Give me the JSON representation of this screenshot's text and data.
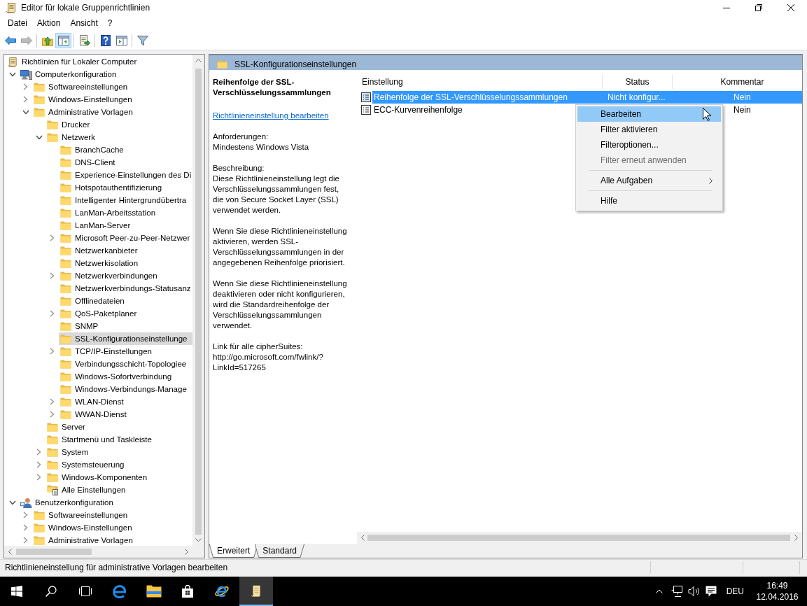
{
  "window": {
    "title": "Editor für lokale Gruppenrichtlinien"
  },
  "menu": [
    "Datei",
    "Aktion",
    "Ansicht",
    "?"
  ],
  "toolbar": [
    {
      "kind": "back",
      "disabled": false,
      "pressed": false
    },
    {
      "kind": "forward",
      "disabled": true,
      "pressed": false
    },
    {
      "kind": "separator"
    },
    {
      "kind": "up",
      "disabled": false,
      "pressed": false
    },
    {
      "kind": "tree",
      "disabled": false,
      "pressed": true
    },
    {
      "kind": "separator"
    },
    {
      "kind": "export",
      "disabled": false,
      "pressed": false
    },
    {
      "kind": "separator"
    },
    {
      "kind": "help",
      "disabled": false,
      "pressed": false
    },
    {
      "kind": "actions",
      "disabled": false,
      "pressed": false
    },
    {
      "kind": "separator"
    },
    {
      "kind": "filter",
      "disabled": false,
      "pressed": false
    }
  ],
  "tree": {
    "items": [
      {
        "label": "Richtlinien für Lokaler Computer",
        "kind": "root",
        "selected": false,
        "children": [
          {
            "label": "Computerkonfiguration",
            "kind": "computer",
            "expanded": true,
            "selected": false,
            "children": [
              {
                "label": "Softwareeinstellungen",
                "kind": "folder",
                "expanded": false,
                "selected": false
              },
              {
                "label": "Windows-Einstellungen",
                "kind": "folder",
                "expanded": false,
                "selected": false
              },
              {
                "label": "Administrative Vorlagen",
                "kind": "folder",
                "expanded": true,
                "selected": false,
                "children": [
                  {
                    "label": "Drucker",
                    "kind": "folder",
                    "selected": false
                  },
                  {
                    "label": "Netzwerk",
                    "kind": "folder",
                    "expanded": true,
                    "selected": false,
                    "children": [
                      {
                        "label": "BranchCache",
                        "kind": "folder",
                        "selected": false
                      },
                      {
                        "label": "DNS-Client",
                        "kind": "folder",
                        "selected": false
                      },
                      {
                        "label": "Experience-Einstellungen des Di",
                        "kind": "folder",
                        "selected": false
                      },
                      {
                        "label": "Hotspotauthentifizierung",
                        "kind": "folder",
                        "selected": false
                      },
                      {
                        "label": "Intelligenter Hintergrundübertra",
                        "kind": "folder",
                        "selected": false
                      },
                      {
                        "label": "LanMan-Arbeitsstation",
                        "kind": "folder",
                        "selected": false
                      },
                      {
                        "label": "LanMan-Server",
                        "kind": "folder",
                        "selected": false
                      },
                      {
                        "label": "Microsoft Peer-zu-Peer-Netzwer",
                        "kind": "folder",
                        "expanded": false,
                        "selected": false
                      },
                      {
                        "label": "Netzwerkanbieter",
                        "kind": "folder",
                        "selected": false
                      },
                      {
                        "label": "Netzwerkisolation",
                        "kind": "folder",
                        "selected": false
                      },
                      {
                        "label": "Netzwerkverbindungen",
                        "kind": "folder",
                        "expanded": false,
                        "selected": false
                      },
                      {
                        "label": "Netzwerkverbindungs-Statusanz",
                        "kind": "folder",
                        "selected": false
                      },
                      {
                        "label": "Offlinedateien",
                        "kind": "folder",
                        "selected": false
                      },
                      {
                        "label": "QoS-Paketplaner",
                        "kind": "folder",
                        "expanded": false,
                        "selected": false
                      },
                      {
                        "label": "SNMP",
                        "kind": "folder",
                        "selected": false
                      },
                      {
                        "label": "SSL-Konfigurationseinstellunge",
                        "kind": "folder",
                        "selected": true
                      },
                      {
                        "label": "TCP/IP-Einstellungen",
                        "kind": "folder",
                        "expanded": false,
                        "selected": false
                      },
                      {
                        "label": "Verbindungsschicht-Topologiee",
                        "kind": "folder",
                        "selected": false
                      },
                      {
                        "label": "Windows-Sofortverbindung",
                        "kind": "folder",
                        "selected": false
                      },
                      {
                        "label": "Windows-Verbindungs-Manage",
                        "kind": "folder",
                        "selected": false
                      },
                      {
                        "label": "WLAN-Dienst",
                        "kind": "folder",
                        "expanded": false,
                        "selected": false
                      },
                      {
                        "label": "WWAN-Dienst",
                        "kind": "folder",
                        "expanded": false,
                        "selected": false
                      }
                    ]
                  },
                  {
                    "label": "Server",
                    "kind": "folder",
                    "selected": false
                  },
                  {
                    "label": "Startmenü und Taskleiste",
                    "kind": "folder",
                    "selected": false
                  },
                  {
                    "label": "System",
                    "kind": "folder",
                    "expanded": false,
                    "selected": false
                  },
                  {
                    "label": "Systemsteuerung",
                    "kind": "folder",
                    "expanded": false,
                    "selected": false
                  },
                  {
                    "label": "Windows-Komponenten",
                    "kind": "folder",
                    "expanded": false,
                    "selected": false
                  },
                  {
                    "label": "Alle Einstellungen",
                    "kind": "all-settings",
                    "selected": false
                  }
                ]
              }
            ]
          },
          {
            "label": "Benutzerkonfiguration",
            "kind": "user",
            "expanded": true,
            "selected": false,
            "children": [
              {
                "label": "Softwareeinstellungen",
                "kind": "folder",
                "expanded": false,
                "selected": false
              },
              {
                "label": "Windows-Einstellungen",
                "kind": "folder",
                "expanded": false,
                "selected": false
              },
              {
                "label": "Administrative Vorlagen",
                "kind": "folder",
                "expanded": false,
                "selected": false
              }
            ]
          }
        ]
      }
    ]
  },
  "content": {
    "title": "SSL-Konfigurationseinstellungen",
    "details": {
      "title": "Reihenfolge der SSL-Verschlüsselungssammlungen",
      "link": "Richtlinieneinstellung bearbeiten",
      "requirements_label": "Anforderungen:",
      "requirements": "Mindestens Windows Vista",
      "description_label": "Beschreibung:",
      "paragraphs": [
        "Diese Richtlinieneinstellung legt die Verschlüsselungssammlungen fest, die von Secure Socket Layer (SSL) verwendet werden.",
        "Wenn Sie diese Richtlinieneinstellung aktivieren, werden SSL-Verschlüsselungssammlungen in der angegebenen Reihenfolge priorisiert.",
        "Wenn Sie diese Richtlinieneinstellung deaktivieren oder nicht konfigurieren, wird die Standardreihenfolge der Verschlüsselungssammlungen verwendet.",
        "Link für alle cipherSuites:\nhttp://go.microsoft.com/fwlink/?LinkId=517265"
      ]
    },
    "table": {
      "columns": [
        "Einstellung",
        "Status",
        "Kommentar"
      ],
      "rows": [
        {
          "name": "Reihenfolge der SSL-Verschlüsselungssammlungen",
          "status": "Nicht konfigur...",
          "comment": "Nein",
          "selected": true
        },
        {
          "name": "ECC-Kurvenreihenfolge",
          "comment": "Nein",
          "selected": false
        }
      ]
    },
    "view_tabs": [
      {
        "label": "Erweitert",
        "selected": true
      },
      {
        "label": "Standard",
        "selected": false
      }
    ]
  },
  "context_menu": {
    "items": [
      {
        "kind": "item",
        "label": "Bearbeiten",
        "selected": true,
        "disabled": false,
        "submenu": false
      },
      {
        "kind": "item",
        "label": "Filter aktivieren",
        "selected": false,
        "disabled": false,
        "submenu": false
      },
      {
        "kind": "item",
        "label": "Filteroptionen...",
        "selected": false,
        "disabled": false,
        "submenu": false
      },
      {
        "kind": "item",
        "label": "Filter erneut anwenden",
        "selected": false,
        "disabled": true,
        "submenu": false
      },
      {
        "kind": "separator"
      },
      {
        "kind": "item",
        "label": "Alle Aufgaben",
        "selected": false,
        "disabled": false,
        "submenu": true
      },
      {
        "kind": "separator"
      },
      {
        "kind": "item",
        "label": "Hilfe",
        "selected": false,
        "disabled": false,
        "submenu": false
      }
    ]
  },
  "status_bar": {
    "text": "Richtlinieneinstellung für administrative Vorlagen bearbeiten"
  },
  "taskbar": {
    "apps": [
      {
        "kind": "start",
        "active": false
      },
      {
        "kind": "search",
        "active": false
      },
      {
        "kind": "task-view",
        "active": false
      },
      {
        "kind": "edge",
        "active": false
      },
      {
        "kind": "explorer",
        "active": false
      },
      {
        "kind": "store",
        "active": false
      },
      {
        "kind": "ie",
        "active": false
      },
      {
        "kind": "gpedit",
        "active": true
      }
    ],
    "language": "DEU",
    "time": "16:49",
    "date": "12.04.2016"
  }
}
